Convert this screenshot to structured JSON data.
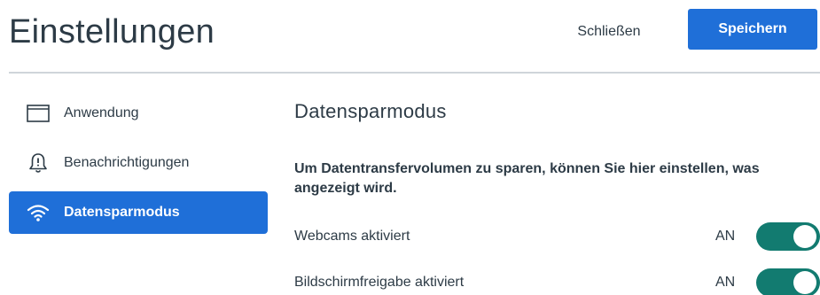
{
  "header": {
    "title": "Einstellungen",
    "close_label": "Schließen",
    "save_label": "Speichern"
  },
  "sidebar": {
    "items": [
      {
        "label": "Anwendung",
        "icon": "window-icon",
        "active": false
      },
      {
        "label": "Benachrichtigungen",
        "icon": "bell-icon",
        "active": false
      },
      {
        "label": "Datensparmodus",
        "icon": "wifi-icon",
        "active": true
      }
    ]
  },
  "main": {
    "section_title": "Datensparmodus",
    "description": "Um Datentransfervolumen zu sparen, können Sie hier einstellen, was angezeigt wird.",
    "settings": [
      {
        "label": "Webcams aktiviert",
        "state": "AN",
        "enabled": true
      },
      {
        "label": "Bildschirmfreigabe aktiviert",
        "state": "AN",
        "enabled": true
      }
    ]
  },
  "colors": {
    "accent": "#1f6fd8",
    "toggle_on": "#127b70",
    "text": "#2d3b46",
    "divider": "#cfd5da"
  }
}
